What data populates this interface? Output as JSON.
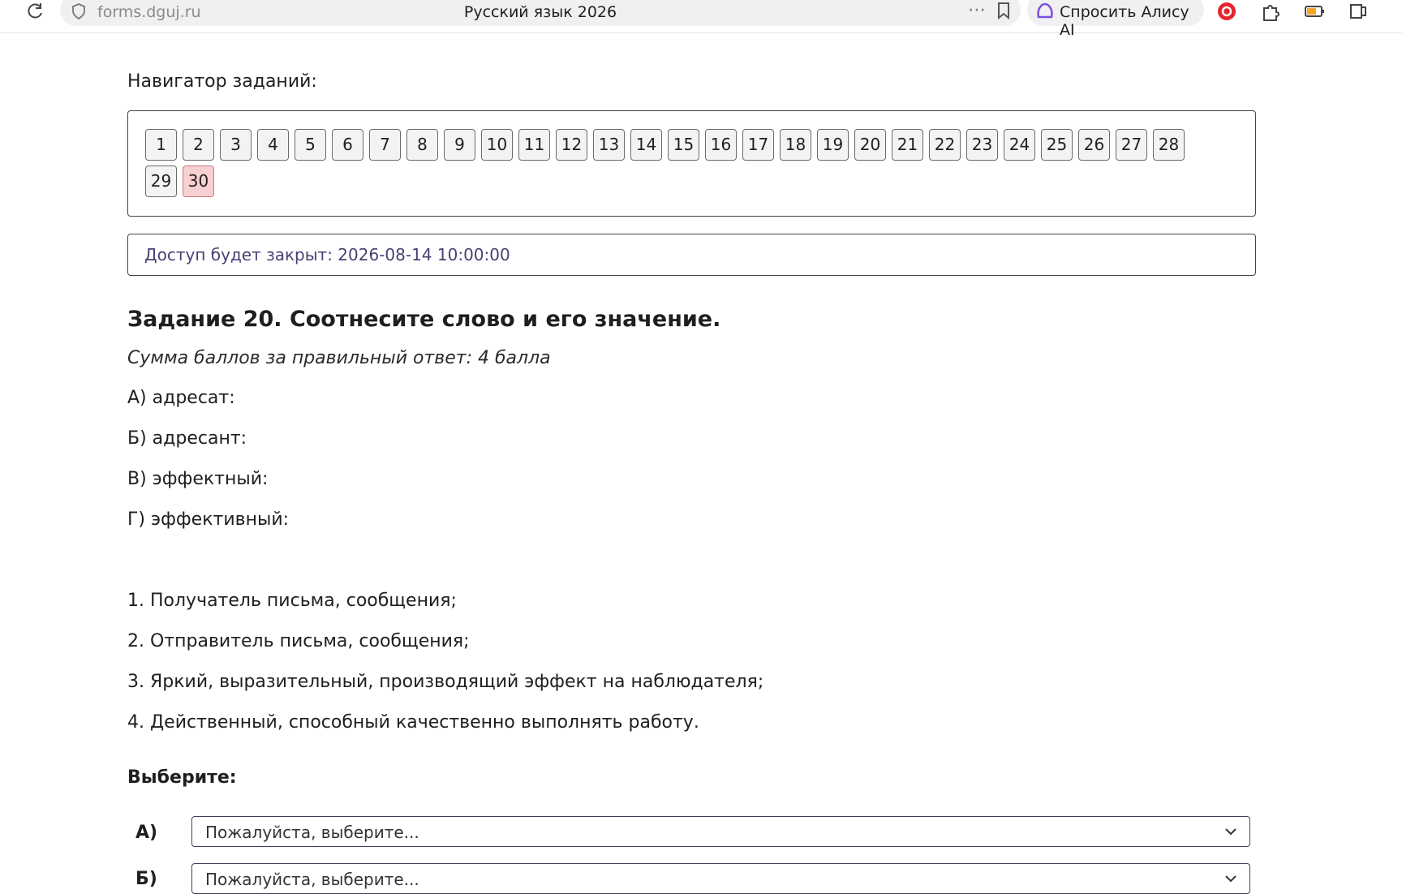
{
  "browser": {
    "url": "forms.dguj.ru",
    "tab_title": "Русский язык 2026",
    "more_icon": "⋯",
    "alice_label": "Спросить Алису AI"
  },
  "navigator": {
    "label": "Навигатор заданий:",
    "questions": [
      "1",
      "2",
      "3",
      "4",
      "5",
      "6",
      "7",
      "8",
      "9",
      "10",
      "11",
      "12",
      "13",
      "14",
      "15",
      "16",
      "17",
      "18",
      "19",
      "20",
      "21",
      "22",
      "23",
      "24",
      "25",
      "26",
      "27",
      "28",
      "29",
      "30"
    ],
    "current": "30",
    "current_color": "#f9d0d2"
  },
  "access": {
    "text": "Доступ будет закрыт: 2026-08-14 10:00:00"
  },
  "task": {
    "title": "Задание 20. Соотнесите слово и его значение.",
    "score": "Сумма баллов за правильный ответ: 4 балла",
    "words": [
      "А) адресат:",
      "Б) адресант:",
      "В) эффектный:",
      "Г) эффективный:"
    ],
    "meanings": [
      "1. Получатель письма, сообщения;",
      "2. Отправитель письма, сообщения;",
      "3. Яркий, выразительный, производящий эффект на наблюдателя;",
      "4. Действенный, способный качественно выполнять работу."
    ]
  },
  "answer": {
    "label": "Выберите:",
    "rows": [
      {
        "letter": "А)",
        "placeholder": "Пожалуйста, выберите..."
      },
      {
        "letter": "Б)",
        "placeholder": "Пожалуйста, выберите..."
      }
    ]
  }
}
